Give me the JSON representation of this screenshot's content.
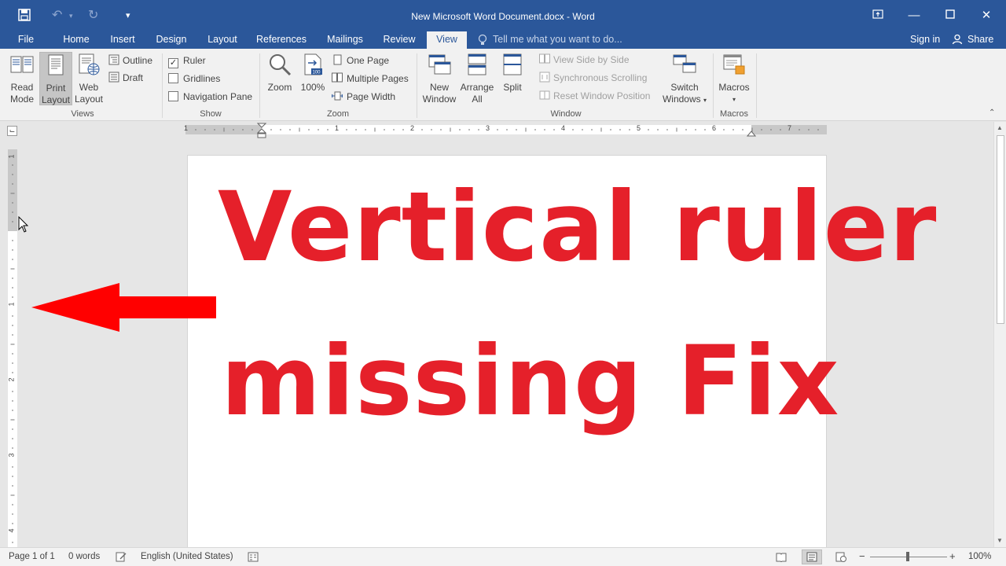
{
  "window": {
    "title": "New Microsoft Word Document.docx - Word"
  },
  "menu": {
    "tabs": [
      "File",
      "Home",
      "Insert",
      "Design",
      "Layout",
      "References",
      "Mailings",
      "Review",
      "View"
    ],
    "active_tab": "View",
    "tell_me": "Tell me what you want to do...",
    "sign_in": "Sign in",
    "share": "Share"
  },
  "ribbon": {
    "views": {
      "label": "Views",
      "read_mode": [
        "Read",
        "Mode"
      ],
      "print_layout": [
        "Print",
        "Layout"
      ],
      "web_layout": [
        "Web",
        "Layout"
      ],
      "outline": "Outline",
      "draft": "Draft"
    },
    "show": {
      "label": "Show",
      "ruler": "Ruler",
      "ruler_checked": true,
      "gridlines": "Gridlines",
      "navigation_pane": "Navigation Pane"
    },
    "zoom": {
      "label": "Zoom",
      "zoom": "Zoom",
      "hundred": "100%",
      "one_page": "One Page",
      "multiple_pages": "Multiple Pages",
      "page_width": "Page Width"
    },
    "window": {
      "label": "Window",
      "new_window": [
        "New",
        "Window"
      ],
      "arrange_all": [
        "Arrange",
        "All"
      ],
      "split": "Split",
      "view_side_by_side": "View Side by Side",
      "synchronous_scrolling": "Synchronous Scrolling",
      "reset_window_position": "Reset Window Position",
      "switch_windows": [
        "Switch",
        "Windows"
      ]
    },
    "macros": {
      "label": "Macros",
      "macros": "Macros"
    }
  },
  "ruler": {
    "h_numbers": [
      "1",
      "1",
      "2",
      "3",
      "4",
      "5",
      "6",
      "7"
    ],
    "v_numbers": [
      "1",
      "1",
      "2",
      "3",
      "4"
    ]
  },
  "document": {
    "line1": "Vertical ruler",
    "line2": "missing  Fix",
    "text_color": "#e5202a",
    "arrow_color": "#ff0000"
  },
  "status": {
    "page": "Page 1 of 1",
    "words": "0 words",
    "language": "English (United States)",
    "zoom": "100%"
  }
}
